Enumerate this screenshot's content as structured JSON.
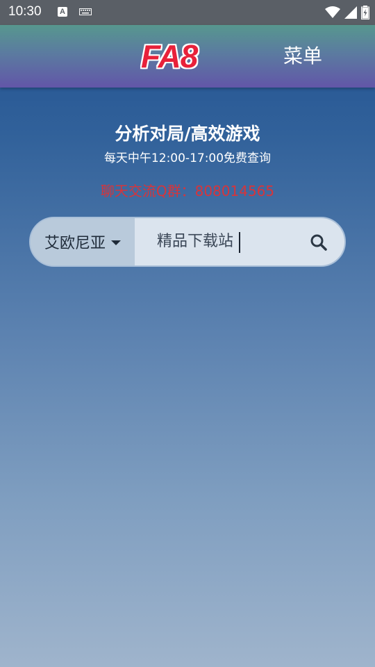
{
  "status_bar": {
    "time": "10:30",
    "a_icon_letter": "A",
    "icons": [
      "keyboard-icon",
      "wifi-icon",
      "signal-icon",
      "battery-charging-icon"
    ]
  },
  "header": {
    "logo_text": "FA8",
    "menu_label": "菜单"
  },
  "hero": {
    "headline": "分析对局/高效游戏",
    "subline": "每天中午12:00-17:00免费查询",
    "qq_group": "聊天交流Q群：808014565"
  },
  "search": {
    "region_selected": "艾欧尼亚",
    "input_value": "精品下载站",
    "search_icon": "search-icon"
  },
  "colors": {
    "logo_red": "#e8213a",
    "qq_red": "#d8343a",
    "header_top": "#57978e",
    "header_bottom": "#6256a8"
  }
}
